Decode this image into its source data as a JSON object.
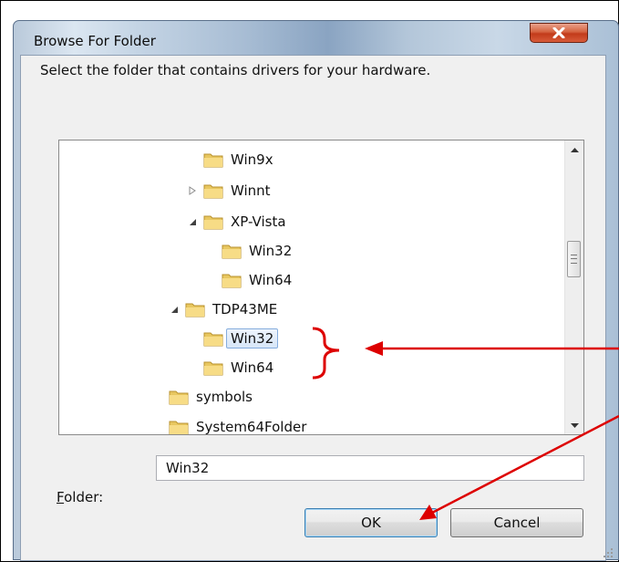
{
  "dialog": {
    "title": "Browse For Folder",
    "instruction": "Select the folder that contains drivers for your hardware."
  },
  "tree": {
    "items": [
      {
        "label": "Win9x",
        "expander": "none"
      },
      {
        "label": "Winnt",
        "expander": "collapsed"
      },
      {
        "label": "XP-Vista",
        "expander": "expanded"
      },
      {
        "label": "Win32",
        "expander": "none"
      },
      {
        "label": "Win64",
        "expander": "none"
      },
      {
        "label": "TDP43ME",
        "expander": "expanded"
      },
      {
        "label": "Win32",
        "expander": "none",
        "selected": true
      },
      {
        "label": "Win64",
        "expander": "none"
      },
      {
        "label": "symbols",
        "expander": "none"
      },
      {
        "label": "System64Folder",
        "expander": "none"
      }
    ]
  },
  "folder_field": {
    "label_prefix": "",
    "label_accel": "F",
    "label_rest": "older:",
    "value": "Win32"
  },
  "buttons": {
    "ok": "OK",
    "cancel": "Cancel"
  },
  "icons": {
    "close": "close-icon",
    "folder": "folder-icon",
    "expand": "triangle-expanded-icon",
    "collapse": "triangle-collapsed-icon"
  },
  "colors": {
    "annotation": "#dd0000",
    "close_button": "#c8452a",
    "selection": "#d7e6f8"
  }
}
